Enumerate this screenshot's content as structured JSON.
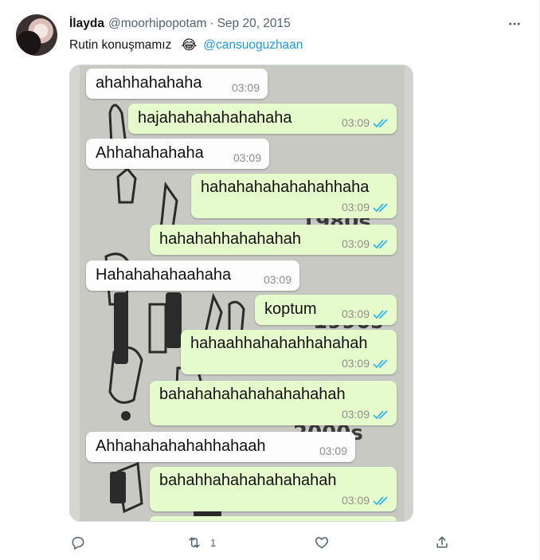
{
  "tweet": {
    "display_name": "İlayda",
    "handle": "@moorhipopotam",
    "separator": "·",
    "date": "Sep 20, 2015",
    "text": "Rutin konuşmamız",
    "emoji": "😂",
    "mention": "@cansuoguzhaan"
  },
  "chat": {
    "messages": [
      {
        "dir": "in",
        "text": "ahahhahahaha",
        "time": "03:09"
      },
      {
        "dir": "out",
        "text": "hajahahahahahahaha",
        "time": "03:09"
      },
      {
        "dir": "in",
        "text": "Ahhahahahaha",
        "time": "03:09"
      },
      {
        "dir": "out",
        "text": "hahahahahahahahhaha",
        "time": "03:09"
      },
      {
        "dir": "out",
        "text": "hahahahhahahahah",
        "time": "03:09"
      },
      {
        "dir": "in",
        "text": "Hahahahahaahaha",
        "time": "03:09"
      },
      {
        "dir": "out",
        "text": "koptum",
        "time": "03:09"
      },
      {
        "dir": "out",
        "text": "hahaahhahahahhahahah",
        "time": "03:09"
      },
      {
        "dir": "out",
        "text": "bahahahahahahahahahah",
        "time": "03:09"
      },
      {
        "dir": "in",
        "text": "Ahhahahahahahhahaah",
        "time": "03:09"
      },
      {
        "dir": "out",
        "text": "bahahhahahahahahahah",
        "time": "03:09"
      }
    ]
  },
  "actions": {
    "retweet_count": "1"
  },
  "colors": {
    "accent": "#1d9bf0",
    "text_secondary": "#536471",
    "bubble_out": "#e5fbcb",
    "bubble_in": "#fdfdfd",
    "tick_blue": "#34b7f1"
  },
  "icons": {
    "more": "more-horizontal-icon",
    "reply": "reply-icon",
    "retweet": "retweet-icon",
    "like": "heart-icon",
    "share": "share-icon",
    "read_receipt": "double-check-icon"
  }
}
